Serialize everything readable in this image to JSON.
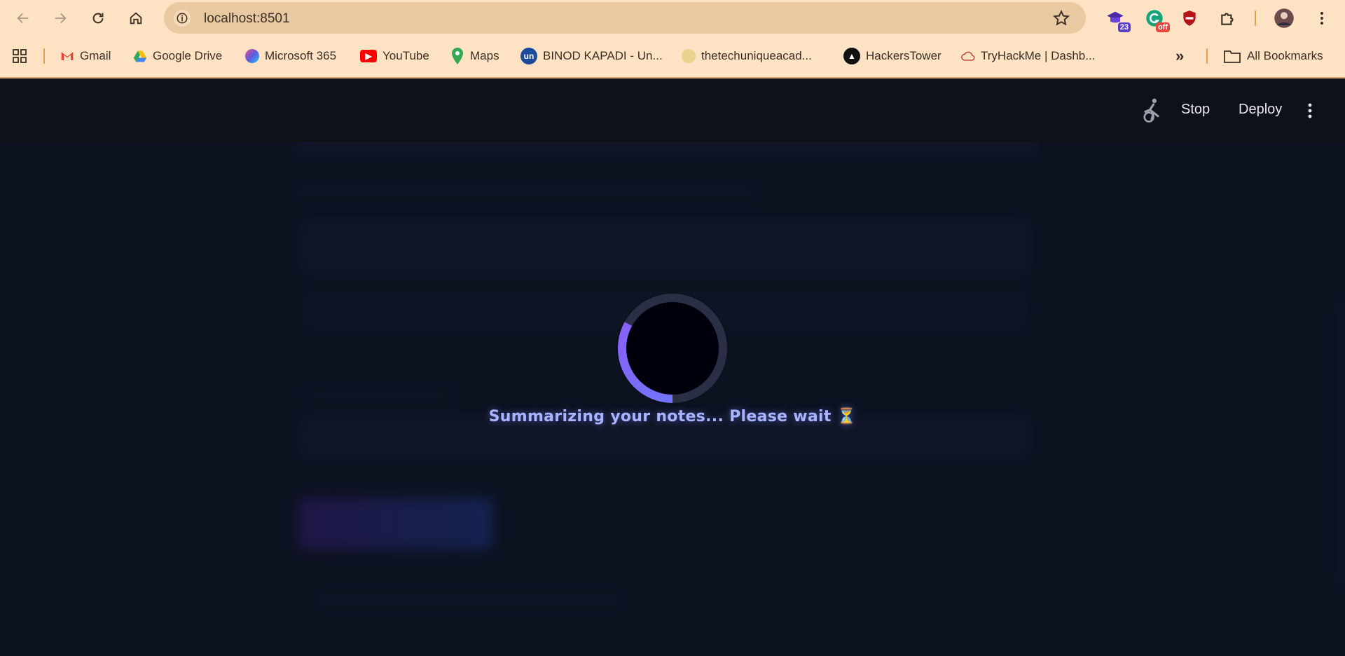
{
  "browser": {
    "url": "localhost:8501",
    "bookmarks": [
      {
        "label": "Gmail",
        "icon": "gmail-icon"
      },
      {
        "label": "Google Drive",
        "icon": "google-drive-icon"
      },
      {
        "label": "Microsoft 365",
        "icon": "microsoft-365-icon"
      },
      {
        "label": "YouTube",
        "icon": "youtube-icon"
      },
      {
        "label": "Maps",
        "icon": "maps-icon"
      },
      {
        "label": "BINOD KAPADI - Un...",
        "icon": "unstop-icon"
      },
      {
        "label": "thetechuniqueacad...",
        "icon": "academy-icon"
      },
      {
        "label": "HackersTower",
        "icon": "hackerstower-icon"
      },
      {
        "label": "TryHackMe | Dashb...",
        "icon": "tryhackme-icon"
      }
    ],
    "all_bookmarks": "All Bookmarks",
    "extensions": [
      {
        "icon": "graduation-cap-icon",
        "badge": "23"
      },
      {
        "icon": "grammarly-icon",
        "badge": "off"
      },
      {
        "icon": "shield-icon",
        "badge": ""
      },
      {
        "icon": "puzzle-icon",
        "badge": ""
      }
    ]
  },
  "app": {
    "header": {
      "stop_label": "Stop",
      "deploy_label": "Deploy"
    },
    "loading": {
      "message": "Summarizing your notes... Please wait ⏳",
      "progress_fraction": 0.33
    }
  },
  "colors": {
    "chrome_bg": "#fde3c4",
    "omnibox_bg": "#e9c9a2",
    "app_header_bg": "#0e1118",
    "app_bg": "#0f1424",
    "spinner_accent": "#7c5cff",
    "text_accent": "#a9b4ff"
  }
}
